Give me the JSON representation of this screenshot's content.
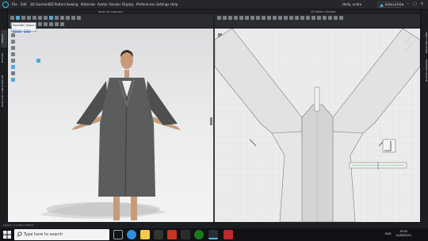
{
  "app": {
    "menus": [
      "File",
      "Edit",
      "3D Garment",
      "2D Pattern",
      "Sewing",
      "Materials",
      "Avatar",
      "Render",
      "Display",
      "Preferences",
      "Settings",
      "Help"
    ],
    "user_label": "Hello, andro",
    "mode_label": "SIMULATION",
    "file_title": "Ameh-01.coat.zpry",
    "pattern_window_title": "2D Pattern Window",
    "window_controls": [
      "–",
      "□",
      "×"
    ]
  },
  "left_tabs": [
    "LIBRARY",
    "HISTORY",
    "MODULAR CONFIGURATOR"
  ],
  "right_tabs": [
    "OBJECT BROWSER",
    "PROPERTY EDITOR"
  ],
  "simulate_popup": {
    "title": "Simulate ( Space )",
    "link_manual": "Manual",
    "link_video": "Video"
  },
  "status_bar": {
    "text": "Version: 5.2.344 (r16512)"
  },
  "taskbar": {
    "search_placeholder": "Type here to search",
    "language": "ENG",
    "time": "15:02",
    "date": "14/05/2021"
  },
  "colors": {
    "accent": "#3ec1e6",
    "garment": "#5a5d5b",
    "pattern_piece": "#e2e2e2",
    "viewport_2d_bg": "#ececec"
  }
}
